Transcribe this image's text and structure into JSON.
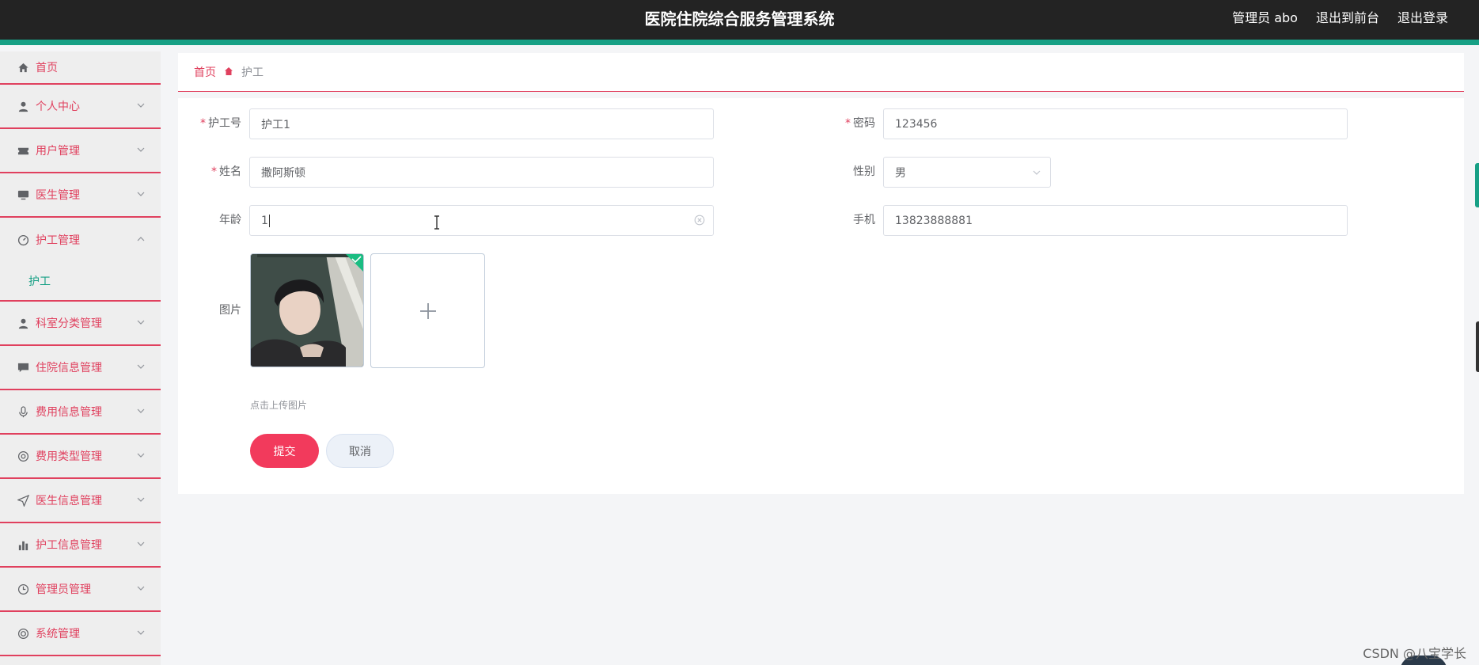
{
  "header": {
    "title": "医院住院综合服务管理系统",
    "user_label": "管理员 abo",
    "to_frontend": "退出到前台",
    "logout": "退出登录",
    "accent_color": "#17a085",
    "bg_color": "#232323"
  },
  "sidebar": {
    "accent_color": "#e0405e",
    "items": [
      {
        "label": "首页",
        "icon": "home-icon",
        "expandable": false
      },
      {
        "label": "个人中心",
        "icon": "user-icon",
        "expandable": true
      },
      {
        "label": "用户管理",
        "icon": "ticket-icon",
        "expandable": true
      },
      {
        "label": "医生管理",
        "icon": "monitor-icon",
        "expandable": true
      },
      {
        "label": "护工管理",
        "icon": "dashboard-icon",
        "expandable": true,
        "expanded": true,
        "children": [
          {
            "label": "护工"
          }
        ]
      },
      {
        "label": "科室分类管理",
        "icon": "user-solid-icon",
        "expandable": true
      },
      {
        "label": "住院信息管理",
        "icon": "chat-icon",
        "expandable": true
      },
      {
        "label": "费用信息管理",
        "icon": "microphone-icon",
        "expandable": true
      },
      {
        "label": "费用类型管理",
        "icon": "help-icon",
        "expandable": true
      },
      {
        "label": "医生信息管理",
        "icon": "send-icon",
        "expandable": true
      },
      {
        "label": "护工信息管理",
        "icon": "data-icon",
        "expandable": true
      },
      {
        "label": "管理员管理",
        "icon": "clock-icon",
        "expandable": true
      },
      {
        "label": "系统管理",
        "icon": "lifebuoy-icon",
        "expandable": true
      }
    ]
  },
  "breadcrumb": {
    "home": "首页",
    "current": "护工"
  },
  "form": {
    "nurse_no": {
      "label": "护工号",
      "required": true,
      "value": "护工1"
    },
    "password": {
      "label": "密码",
      "required": true,
      "value": "123456"
    },
    "name": {
      "label": "姓名",
      "required": true,
      "value": "撒阿斯顿"
    },
    "gender": {
      "label": "性别",
      "required": false,
      "value": "男"
    },
    "age": {
      "label": "年龄",
      "required": false,
      "value": "1"
    },
    "phone": {
      "label": "手机",
      "required": false,
      "value": "13823888881"
    },
    "image": {
      "label": "图片",
      "upload_tip": "点击上传图片"
    },
    "submit_label": "提交",
    "cancel_label": "取消",
    "submit_color": "#f23a5c"
  },
  "watermark": "CSDN @八宝学长"
}
